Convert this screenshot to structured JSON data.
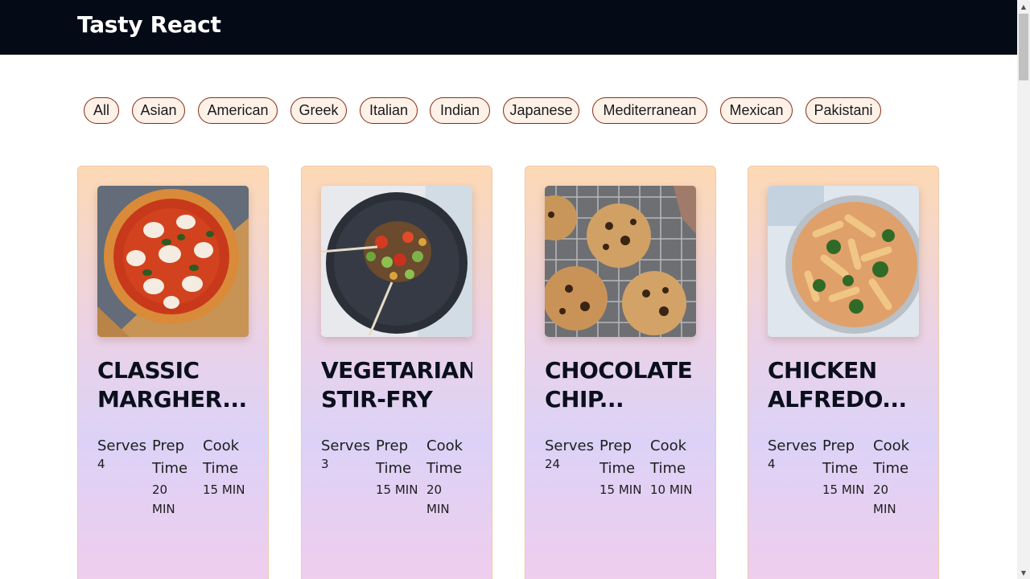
{
  "header": {
    "brand": "Tasty React"
  },
  "filters": [
    "All",
    "Asian",
    "American",
    "Greek",
    "Italian",
    "Indian",
    "Japanese",
    "Mediterranean",
    "Mexican",
    "Pakistani"
  ],
  "labels": {
    "serves": "Serves",
    "prep_line1": "Prep",
    "prep_line2": "Time",
    "cook_line1": "Cook",
    "cook_line2": "Time"
  },
  "recipes": [
    {
      "title_line1": "CLASSIC",
      "title_line2": "MARGHER...",
      "serves": "4",
      "prep_a": "20",
      "prep_b": "MIN",
      "cook_a": "15 MIN",
      "cook_b": "",
      "image": "pizza-image"
    },
    {
      "title_line1": "VEGETARIAN",
      "title_line2": "STIR-FRY",
      "serves": "3",
      "prep_a": "15 MIN",
      "prep_b": "",
      "cook_a": "20",
      "cook_b": "MIN",
      "image": "stir-fry-image"
    },
    {
      "title_line1": "CHOCOLATE",
      "title_line2": "CHIP...",
      "serves": "24",
      "prep_a": "15 MIN",
      "prep_b": "",
      "cook_a": "10 MIN",
      "cook_b": "",
      "image": "cookies-image"
    },
    {
      "title_line1": "CHICKEN",
      "title_line2": "ALFREDO...",
      "serves": "4",
      "prep_a": "15 MIN",
      "prep_b": "",
      "cook_a": "20",
      "cook_b": "MIN",
      "image": "pasta-image"
    }
  ],
  "colors": {
    "header_bg": "#050b16",
    "chip_border": "#8a2e14",
    "chip_bg": "#fdf1e8"
  }
}
